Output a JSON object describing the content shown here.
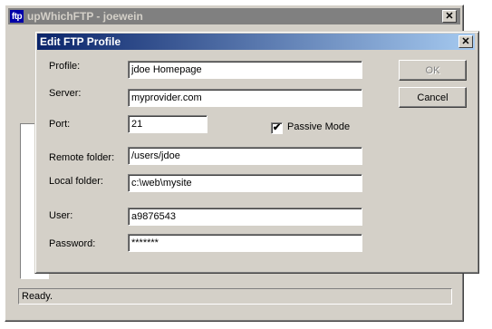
{
  "main_window": {
    "logo_text": "ftp",
    "title": "upWhichFTP - joewein",
    "close_glyph": "✕",
    "status": "Ready."
  },
  "dialog": {
    "title": "Edit FTP Profile",
    "close_glyph": "✕",
    "fields": {
      "profile": {
        "label": "Profile:",
        "value": "jdoe Homepage"
      },
      "server": {
        "label": "Server:",
        "value": "myprovider.com"
      },
      "port": {
        "label": "Port:",
        "value": "21"
      },
      "remote_folder": {
        "label": "Remote folder:",
        "value": "/users/jdoe"
      },
      "local_folder": {
        "label": "Local folder:",
        "value": "c:\\web\\mysite"
      },
      "user": {
        "label": "User:",
        "value": "a9876543"
      },
      "password": {
        "label": "Password:",
        "value": "*******"
      }
    },
    "passive_mode": {
      "label": "Passive Mode",
      "checked": true,
      "check_glyph": "✔"
    },
    "buttons": {
      "ok": "OK",
      "cancel": "Cancel"
    }
  },
  "colors": {
    "dialog_title_start": "#0a246a",
    "dialog_title_end": "#a6caf0",
    "inactive_title": "#808080",
    "face": "#d4d0c8"
  }
}
